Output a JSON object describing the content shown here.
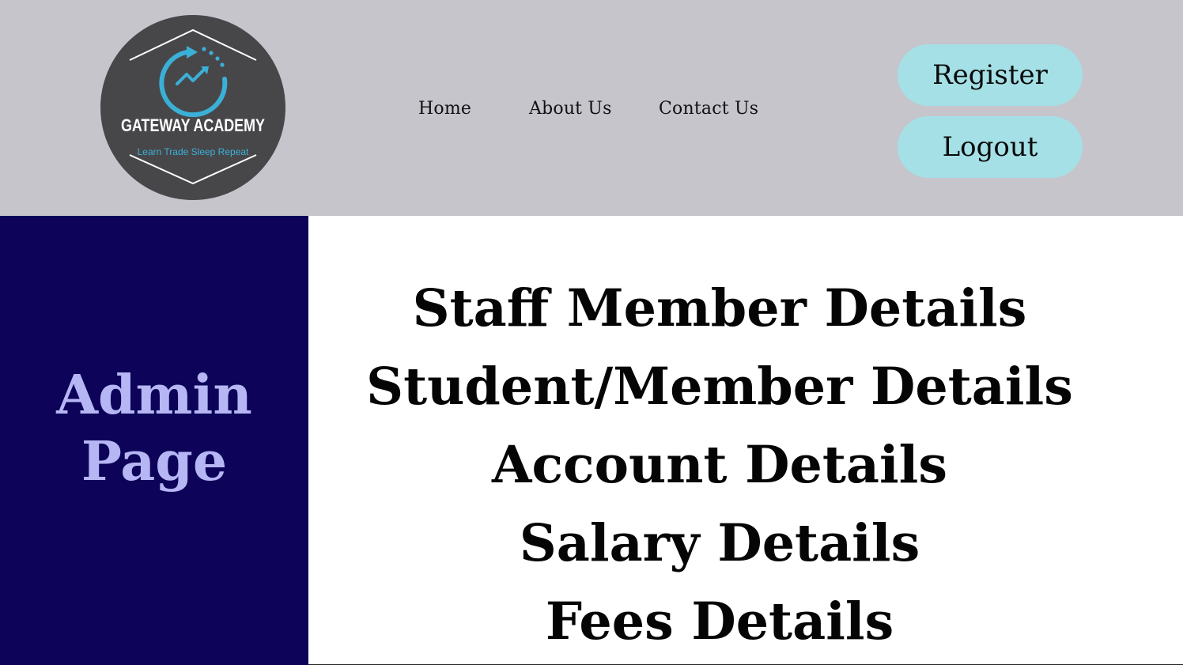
{
  "logo": {
    "name": "GATEWAY ACADEMY",
    "tagline": "Learn Trade Sleep Repeat"
  },
  "nav": {
    "home": "Home",
    "about": "About Us",
    "contact": "Contact Us"
  },
  "auth": {
    "register": "Register",
    "logout": "Logout"
  },
  "sidebar": {
    "title_line1": "Admin",
    "title_line2": "Page"
  },
  "menu": {
    "items": [
      "Staff Member Details",
      "Student/Member Details",
      "Account Details",
      "Salary Details",
      "Fees Details"
    ]
  },
  "colors": {
    "header_bg": "#c6c5cc",
    "button_bg": "#a4e0e6",
    "sidebar_bg": "#0d0459",
    "sidebar_text": "#b6b6f4",
    "logo_accent": "#3bb0d6"
  }
}
